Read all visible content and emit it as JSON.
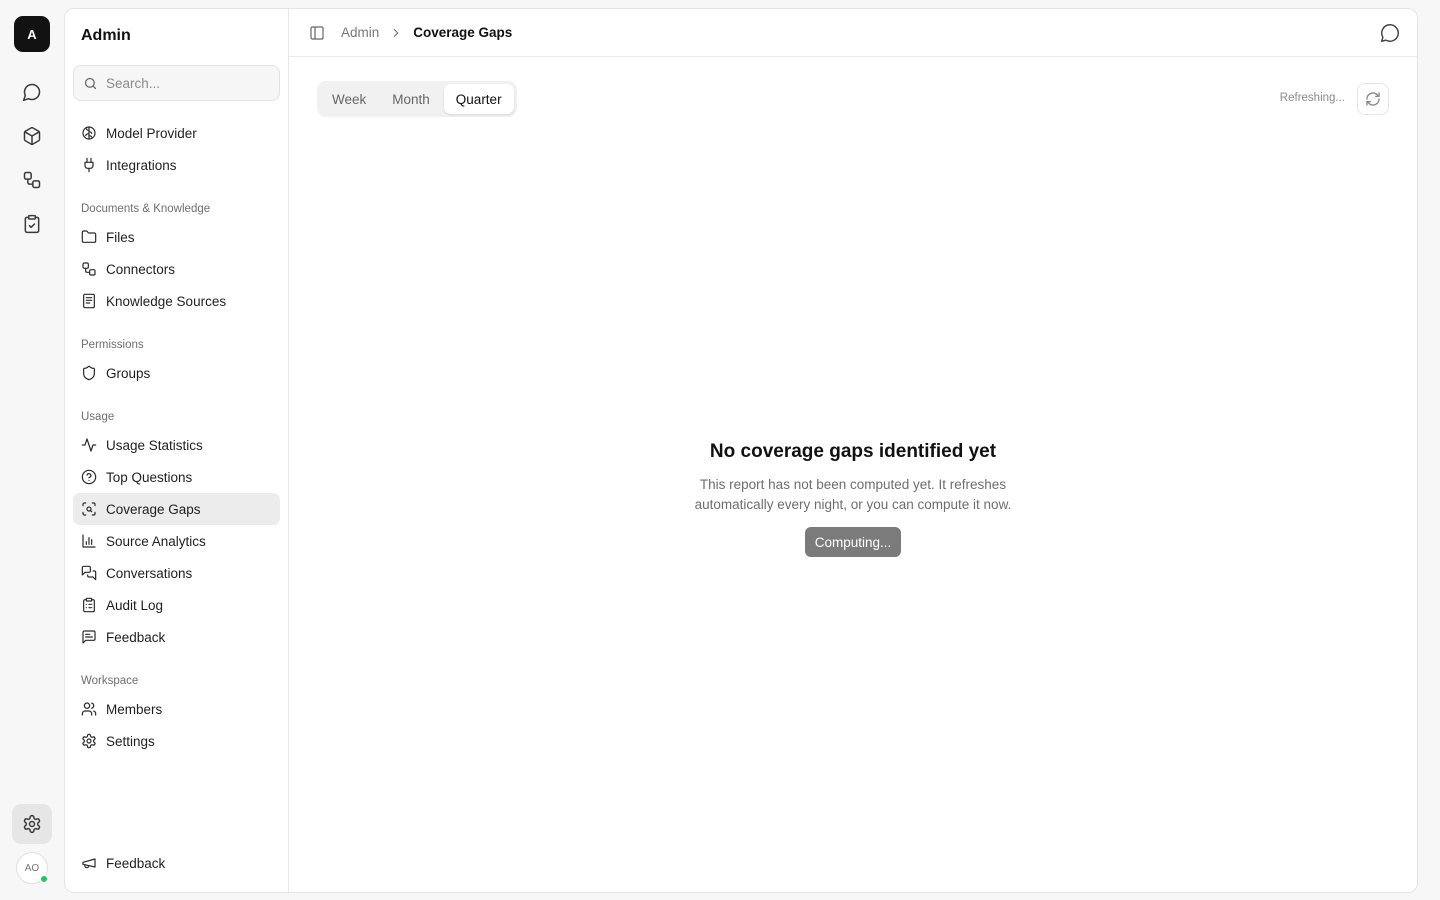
{
  "rail": {
    "logo": "A",
    "icons": [
      "chat-icon",
      "cube-icon",
      "workflow-icon",
      "clipboard-check-icon"
    ],
    "avatar": "AO"
  },
  "sidebar": {
    "title": "Admin",
    "search_placeholder": "Search...",
    "top_items": [
      {
        "label": "Model Provider",
        "icon": "brain-icon"
      },
      {
        "label": "Integrations",
        "icon": "plug-icon"
      }
    ],
    "sections": [
      {
        "heading": "Documents & Knowledge",
        "items": [
          {
            "label": "Files",
            "icon": "folder-icon"
          },
          {
            "label": "Connectors",
            "icon": "connector-icon"
          },
          {
            "label": "Knowledge Sources",
            "icon": "book-icon"
          }
        ]
      },
      {
        "heading": "Permissions",
        "items": [
          {
            "label": "Groups",
            "icon": "shield-icon"
          }
        ]
      },
      {
        "heading": "Usage",
        "items": [
          {
            "label": "Usage Statistics",
            "icon": "activity-icon"
          },
          {
            "label": "Top Questions",
            "icon": "help-circle-icon"
          },
          {
            "label": "Coverage Gaps",
            "icon": "scan-search-icon",
            "active": true
          },
          {
            "label": "Source Analytics",
            "icon": "bar-chart-icon"
          },
          {
            "label": "Conversations",
            "icon": "messages-icon"
          },
          {
            "label": "Audit Log",
            "icon": "clipboard-list-icon"
          },
          {
            "label": "Feedback",
            "icon": "message-square-text-icon"
          }
        ]
      },
      {
        "heading": "Workspace",
        "items": [
          {
            "label": "Members",
            "icon": "users-icon"
          },
          {
            "label": "Settings",
            "icon": "gear-icon"
          }
        ]
      }
    ],
    "bottom_item": {
      "label": "Feedback",
      "icon": "megaphone-icon"
    }
  },
  "header": {
    "breadcrumb_parent": "Admin",
    "breadcrumb_current": "Coverage Gaps"
  },
  "toolbar": {
    "tabs": [
      {
        "label": "Week",
        "active": false
      },
      {
        "label": "Month",
        "active": false
      },
      {
        "label": "Quarter",
        "active": true
      }
    ],
    "refresh_status": "Refreshing..."
  },
  "empty_state": {
    "title": "No coverage gaps identified yet",
    "description": "This report has not been computed yet. It refreshes automatically every night, or you can compute it now.",
    "button": "Computing..."
  },
  "colors": {
    "status_online": "#22c55e",
    "button_disabled": "#7b7b7b",
    "active_item_bg": "#ececec"
  }
}
